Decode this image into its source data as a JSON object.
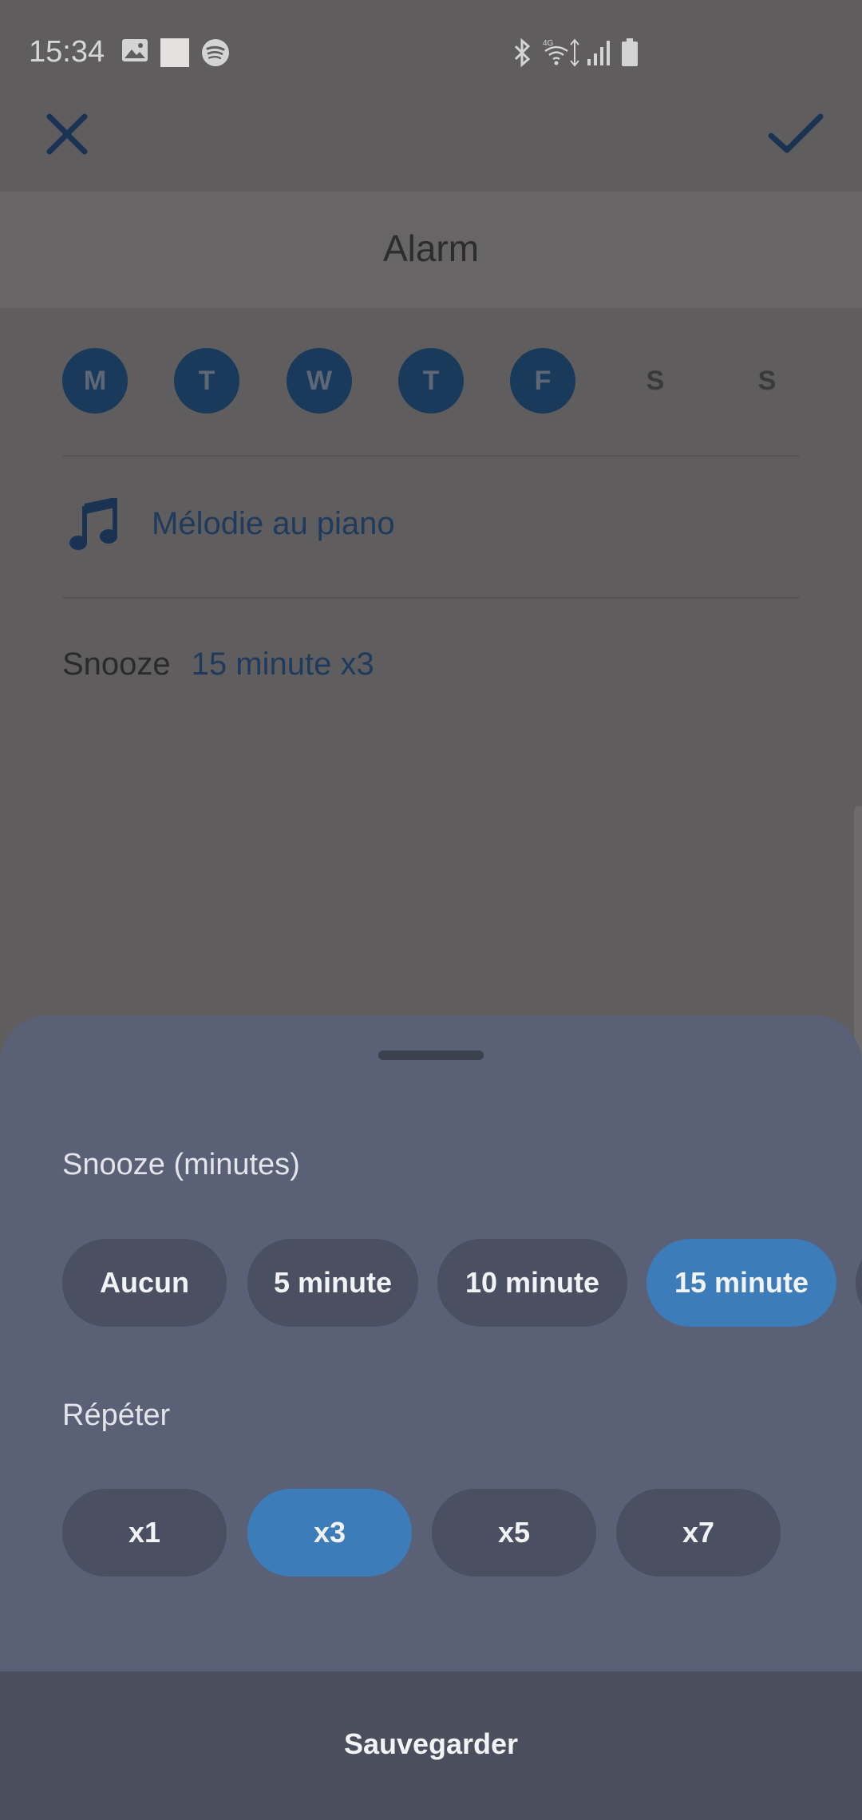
{
  "status_bar": {
    "time": "15:34"
  },
  "header": {
    "title": "Alarm"
  },
  "days": [
    {
      "label": "M",
      "active": true
    },
    {
      "label": "T",
      "active": true
    },
    {
      "label": "W",
      "active": true
    },
    {
      "label": "T",
      "active": true
    },
    {
      "label": "F",
      "active": true
    },
    {
      "label": "S",
      "active": false
    },
    {
      "label": "S",
      "active": false
    }
  ],
  "melody": {
    "label": "Mélodie au piano",
    "icon": "music-note-icon"
  },
  "snooze_summary": {
    "label": "Snooze",
    "value": "15 minute x3"
  },
  "sheet": {
    "snooze_title": "Snooze (minutes)",
    "snooze_options": [
      "Aucun",
      "5 minute",
      "10 minute",
      "15 minute"
    ],
    "snooze_selected": "15 minute",
    "repeat_title": "Répéter",
    "repeat_options": [
      "x1",
      "x3",
      "x5",
      "x7"
    ],
    "repeat_selected": "x3",
    "save_label": "Sauvegarder"
  },
  "colors": {
    "accent": "#3c7cb8",
    "day_active": "#193a5a",
    "sheet_bg": "#5a6076",
    "overlay_bg": "#5f5d5e"
  }
}
